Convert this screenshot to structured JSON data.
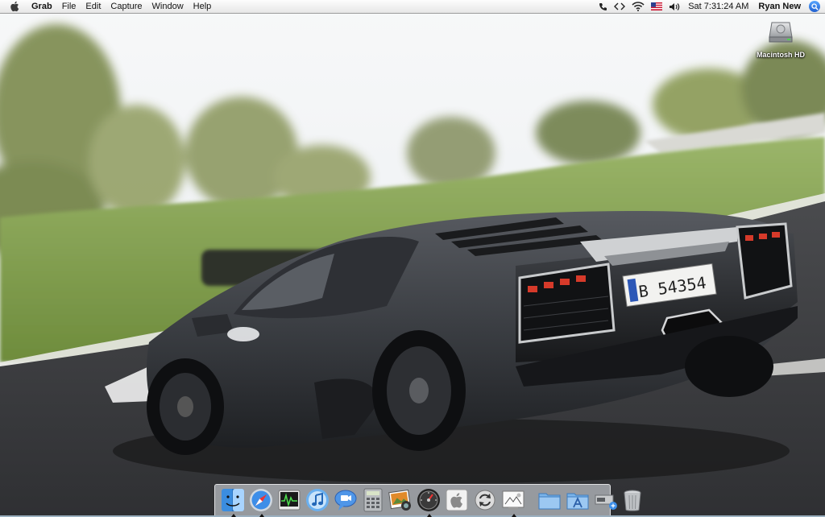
{
  "menubar": {
    "apple_icon": "apple-icon",
    "app_name": "Grab",
    "menus": [
      "File",
      "Edit",
      "Capture",
      "Window",
      "Help"
    ],
    "status_icons": [
      "phone-icon",
      "sync-icon",
      "wifi-icon",
      "us-flag-icon",
      "volume-icon"
    ],
    "clock": "Sat 7:31:24 AM",
    "user": "Ryan New",
    "spotlight_icon": "spotlight-icon"
  },
  "desktop": {
    "wallpaper": "lamborghini-reventon-wallpaper",
    "license_plate": "B 54354",
    "icons": [
      {
        "label": "Macintosh HD",
        "icon": "hard-drive-icon"
      }
    ]
  },
  "dock": {
    "apps": [
      {
        "icon": "finder-icon",
        "running": true
      },
      {
        "icon": "safari-icon",
        "running": true
      },
      {
        "icon": "activity-monitor-icon",
        "running": false
      },
      {
        "icon": "itunes-icon",
        "running": false
      },
      {
        "icon": "ichat-icon",
        "running": false
      },
      {
        "icon": "calculator-icon",
        "running": false
      },
      {
        "icon": "iphoto-icon",
        "running": false
      },
      {
        "icon": "dashboard-icon",
        "running": true
      },
      {
        "icon": "apple-logo-icon",
        "running": false
      },
      {
        "icon": "sync-app-icon",
        "running": false
      },
      {
        "icon": "grab-icon",
        "running": true
      }
    ],
    "others": [
      {
        "icon": "documents-folder-icon"
      },
      {
        "icon": "applications-folder-icon"
      },
      {
        "icon": "network-icon"
      },
      {
        "icon": "trash-icon"
      }
    ]
  },
  "colors": {
    "menubar_bg": "#f0f0f0",
    "spotlight_blue": "#2b6fd6",
    "car_body": "#3a3d42",
    "sky": "#f4f6f8",
    "grass": "#7c9a4a",
    "road": "#3d3e41"
  }
}
